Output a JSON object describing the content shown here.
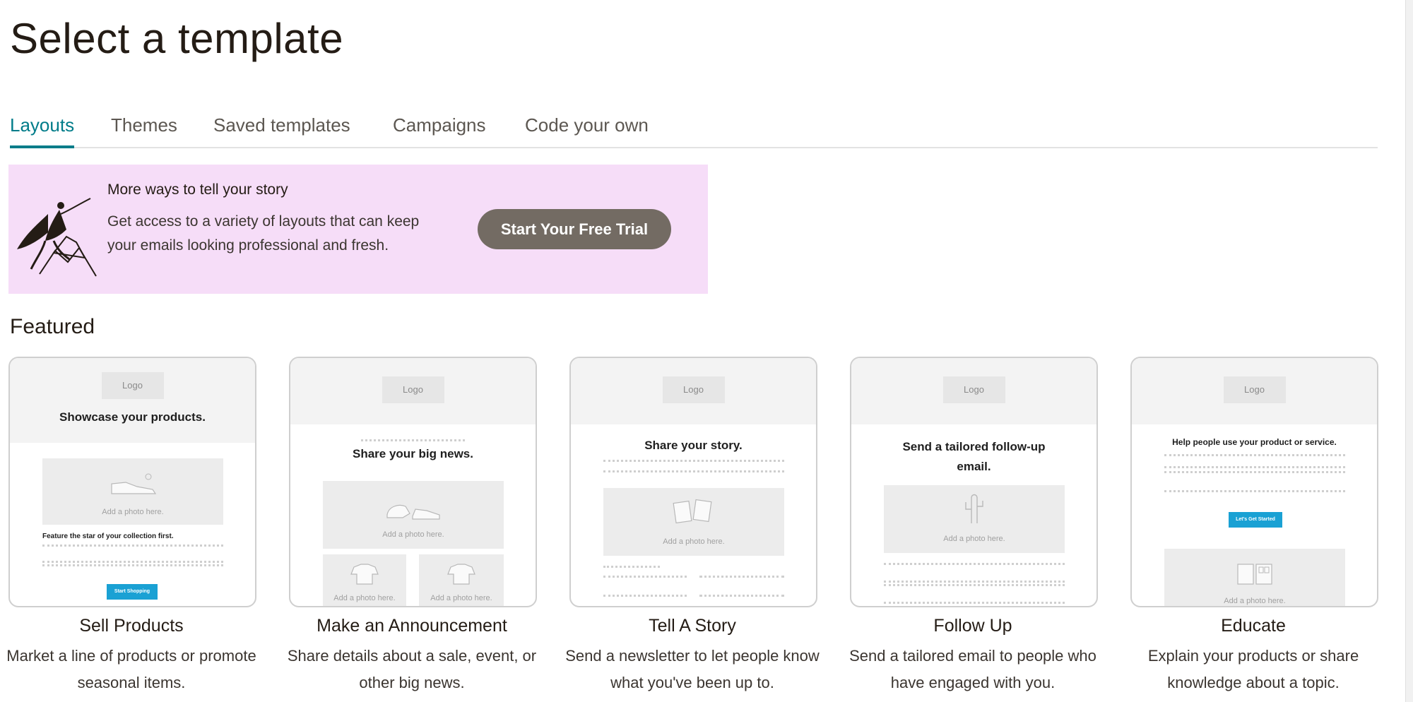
{
  "page": {
    "title": "Select a template"
  },
  "tabs": [
    {
      "label": "Layouts",
      "active": true
    },
    {
      "label": "Themes",
      "active": false
    },
    {
      "label": "Saved templates",
      "active": false
    },
    {
      "label": "Campaigns",
      "active": false
    },
    {
      "label": "Code your own",
      "active": false
    }
  ],
  "promo": {
    "heading": "More ways to tell your story",
    "body": "Get access to a variety of layouts that can keep your emails looking professional and fresh.",
    "button_label": "Start Your Free Trial",
    "background": "#f6ddf8",
    "button_color": "#736b63"
  },
  "section": {
    "title": "Featured"
  },
  "accent_color": "#007c89",
  "cards": [
    {
      "title": "Sell Products",
      "description": "Market a line of products or promote seasonal items.",
      "preview": {
        "logo": "Logo",
        "headline": "Showcase your products.",
        "photo_label": "Add a photo here.",
        "subheading": "Feature the star of your collection first.",
        "cta": "Start Shopping",
        "icon": "shoe-icon"
      }
    },
    {
      "title": "Make an Announcement",
      "description": "Share details about a sale, event, or other big news.",
      "preview": {
        "logo": "Logo",
        "headline": "Share your big news.",
        "photo_label": "Add a photo here.",
        "photo_label_2": "Add a photo here.",
        "photo_label_3": "Add a photo here.",
        "icon": "shoes-icon"
      }
    },
    {
      "title": "Tell A Story",
      "description": "Send a newsletter to let people know what you've been up to.",
      "preview": {
        "logo": "Logo",
        "headline": "Share your story.",
        "photo_label": "Add a photo here.",
        "icon": "cards-icon"
      }
    },
    {
      "title": "Follow Up",
      "description": "Send a tailored email to people who have engaged with you.",
      "preview": {
        "logo": "Logo",
        "headline": "Send a tailored follow-up email.",
        "photo_label": "Add a photo here.",
        "icon": "cactus-icon"
      }
    },
    {
      "title": "Educate",
      "description": "Explain your products or share knowledge about a topic.",
      "preview": {
        "logo": "Logo",
        "headline": "Help people use your product or service.",
        "cta": "Let's Get Started",
        "photo_label": "Add a photo here.",
        "icon": "book-icon"
      }
    }
  ]
}
